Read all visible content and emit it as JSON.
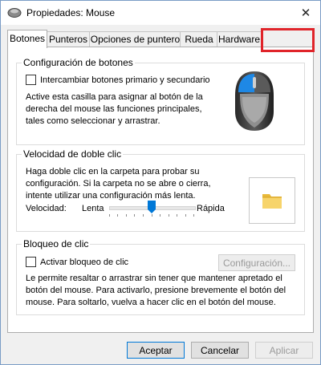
{
  "window": {
    "title": "Propiedades: Mouse",
    "close_symbol": "✕"
  },
  "tabs": [
    {
      "label": "Botones",
      "active": true
    },
    {
      "label": "Punteros",
      "active": false
    },
    {
      "label": "Opciones de puntero",
      "active": false
    },
    {
      "label": "Rueda",
      "active": false
    },
    {
      "label": "Hardware",
      "active": false
    }
  ],
  "button_config": {
    "legend": "Configuración de botones",
    "swap_label": "Intercambiar botones primario y secundario",
    "swap_checked": false,
    "description_lines": [
      "Active esta casilla para asignar al botón de la",
      "derecha del mouse las funciones principales,",
      "tales como seleccionar y arrastrar."
    ]
  },
  "double_click": {
    "legend": "Velocidad de doble clic",
    "description_lines": [
      "Haga doble clic en la carpeta para probar su",
      "configuración. Si la carpeta no se abre o cierra,",
      "intente utilizar una configuración más lenta."
    ],
    "speed_label": "Velocidad:",
    "slow_label": "Lenta",
    "fast_label": "Rápida",
    "slider_level": 0.5
  },
  "click_lock": {
    "legend": "Bloqueo de clic",
    "enable_label": "Activar bloqueo de clic",
    "enabled": false,
    "settings_button": "Configuración...",
    "description_lines": [
      "Le permite resaltar o arrastrar sin tener que mantener apretado el",
      "botón del mouse. Para activarlo, presione brevemente el botón del",
      "mouse. Para soltarlo, vuelva a hacer clic en el botón del mouse."
    ]
  },
  "footer": {
    "ok": "Aceptar",
    "cancel": "Cancelar",
    "apply": "Aplicar"
  },
  "colors": {
    "highlight": "#e0242a",
    "accent": "#0078d7"
  }
}
